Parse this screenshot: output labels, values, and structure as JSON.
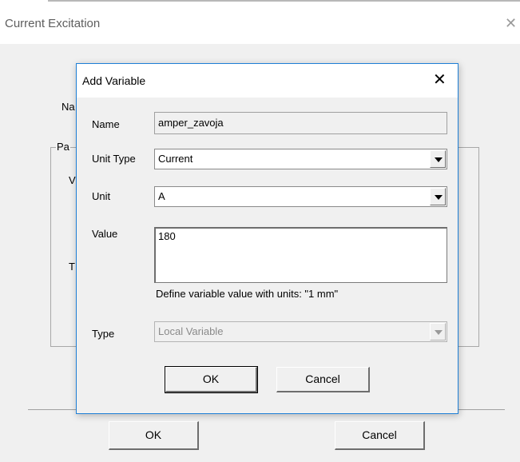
{
  "outer_window": {
    "title": "Current Excitation",
    "close_glyph": "✕",
    "partial_labels": {
      "name": "Na",
      "parameters": "Pa",
      "value": "V",
      "type": "T"
    },
    "buttons": {
      "ok": "OK",
      "cancel": "Cancel"
    }
  },
  "dialog": {
    "title": "Add Variable",
    "close_glyph": "✕",
    "name_label": "Name",
    "name_value": "amper_zavoja",
    "unit_type_label": "Unit Type",
    "unit_type_value": "Current",
    "unit_label": "Unit",
    "unit_value": "A",
    "value_label": "Value",
    "value_value": "180",
    "hint": "Define variable value with units: \"1 mm\"",
    "type_label": "Type",
    "type_value": "Local Variable",
    "ok": "OK",
    "cancel": "Cancel"
  }
}
